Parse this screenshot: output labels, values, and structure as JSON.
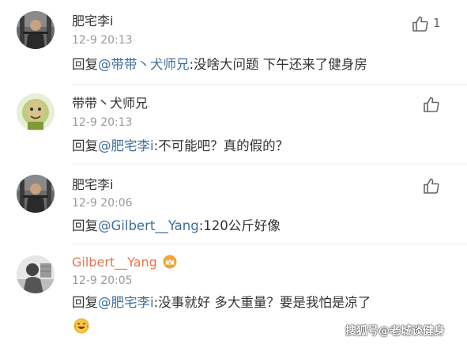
{
  "comments": [
    {
      "username": "肥宅李i",
      "time": "12-9 20:13",
      "reply_prefix": "回复",
      "mention": "@带带丶犬师兄",
      "text": ":没啥大问题 下午还来了健身房",
      "like_count": "1"
    },
    {
      "username": "带带丶犬师兄",
      "time": "12-9 20:13",
      "reply_prefix": "回复",
      "mention": "@肥宅李i",
      "text": ":不可能吧？真的假的？"
    },
    {
      "username": "肥宅李i",
      "time": "12-9 20:06",
      "reply_prefix": "回复",
      "mention": "@Gilbert__Yang",
      "text": ":120公斤好像"
    },
    {
      "username": "Gilbert__Yang",
      "time": "12-9 20:05",
      "reply_prefix": "回复",
      "mention": "@肥宅李i",
      "text": ":没事就好 多大重量？要是我怕是凉了"
    }
  ],
  "watermark": "搜狐号@老城谈健身",
  "icons": {
    "like": "thumbs-up-icon",
    "badge": "crown-badge-icon",
    "emoji": "laugh-cry-emoji-icon"
  },
  "colors": {
    "mention": "#3f6e9b",
    "orange_username": "#eb7350",
    "time": "#999999",
    "text": "#333333"
  }
}
